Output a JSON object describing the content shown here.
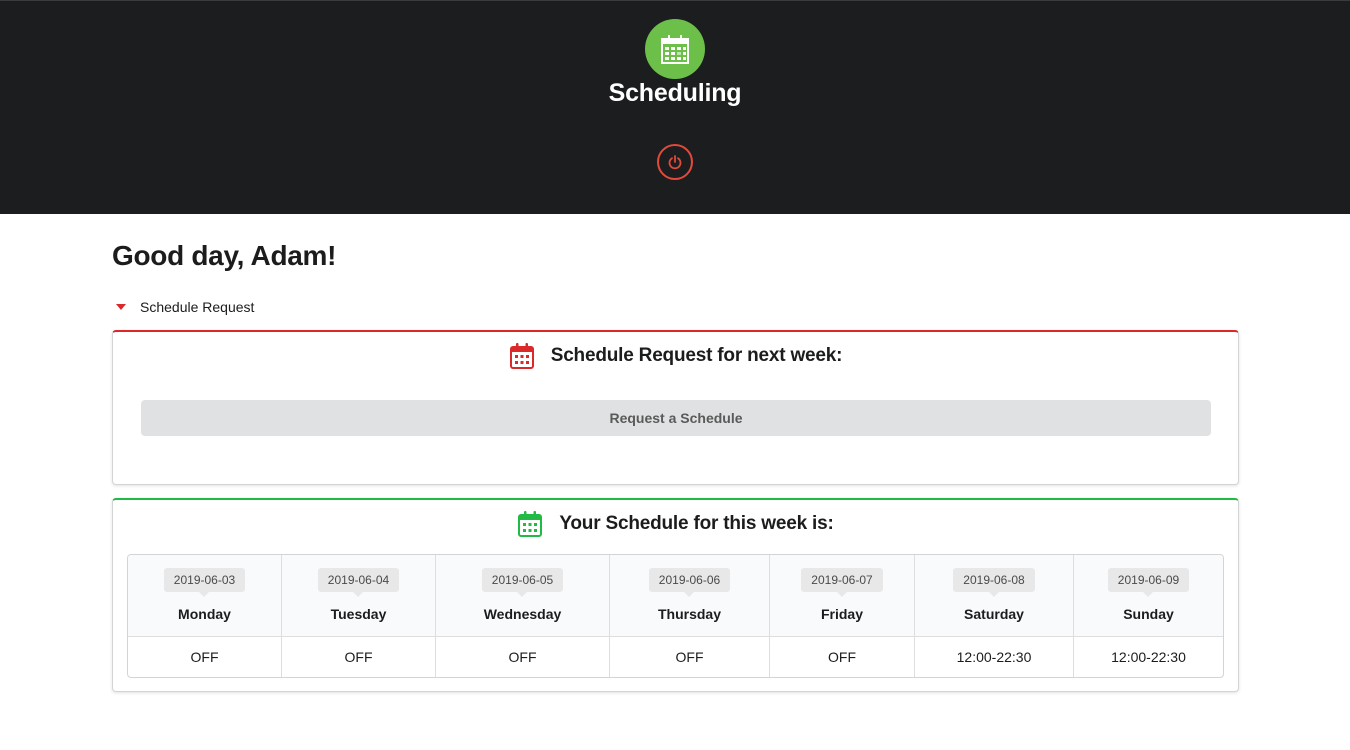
{
  "app": {
    "title": "Scheduling",
    "logo_icon": "calendar-icon",
    "logout_icon": "power-icon",
    "brand_color": "#6cc04a"
  },
  "greeting": "Good day, Adam!",
  "accordion": {
    "label": "Schedule Request",
    "expanded": true
  },
  "request_card": {
    "title": "Schedule Request for next week:",
    "icon": "calendar-icon",
    "accent": "#db2828",
    "button_label": "Request a Schedule"
  },
  "schedule_card": {
    "title": "Your Schedule for this week is:",
    "icon": "calendar-icon",
    "accent": "#21ba45",
    "days": [
      {
        "date": "2019-06-03",
        "name": "Monday",
        "shift": "OFF"
      },
      {
        "date": "2019-06-04",
        "name": "Tuesday",
        "shift": "OFF"
      },
      {
        "date": "2019-06-05",
        "name": "Wednesday",
        "shift": "OFF"
      },
      {
        "date": "2019-06-06",
        "name": "Thursday",
        "shift": "OFF"
      },
      {
        "date": "2019-06-07",
        "name": "Friday",
        "shift": "OFF"
      },
      {
        "date": "2019-06-08",
        "name": "Saturday",
        "shift": "12:00-22:30"
      },
      {
        "date": "2019-06-09",
        "name": "Sunday",
        "shift": "12:00-22:30"
      }
    ]
  }
}
